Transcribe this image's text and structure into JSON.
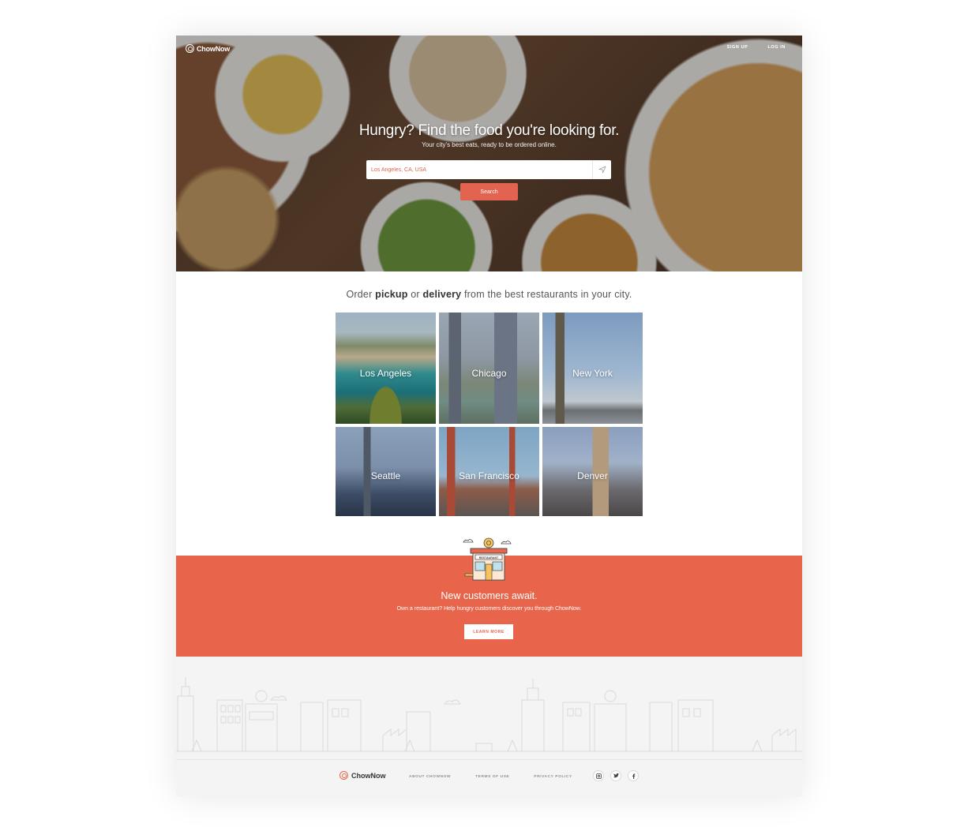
{
  "header": {
    "brand": "ChowNow",
    "nav": {
      "signup": "SIGN UP",
      "login": "LOG IN"
    }
  },
  "hero": {
    "title": "Hungry? Find the food you're looking for.",
    "subtitle": "Your city's best eats, ready to be ordered online.",
    "search": {
      "value": "Los Angeles, CA, USA",
      "button": "Search"
    }
  },
  "tagline": {
    "prefix": "Order ",
    "pickup": "pickup",
    "or": " or ",
    "delivery": "delivery",
    "suffix": " from the best restaurants in your city."
  },
  "cities": [
    "Los Angeles",
    "Chicago",
    "New York",
    "Seattle",
    "San Francisco",
    "Denver"
  ],
  "banner": {
    "icon_label": "RESTAURANT",
    "title": "New customers await.",
    "subtitle": "Own a restaurant? Help hungry customers discover you through ChowNow.",
    "button": "LEARN MORE"
  },
  "footer": {
    "brand": "ChowNow",
    "links": [
      "ABOUT CHOWNOW",
      "TERMS OF USE",
      "PRIVACY POLICY"
    ],
    "social": [
      "instagram-icon",
      "twitter-icon",
      "facebook-icon"
    ]
  },
  "colors": {
    "accent": "#e8654b",
    "button": "#e2634f",
    "footer_bg": "#f4f4f4"
  }
}
